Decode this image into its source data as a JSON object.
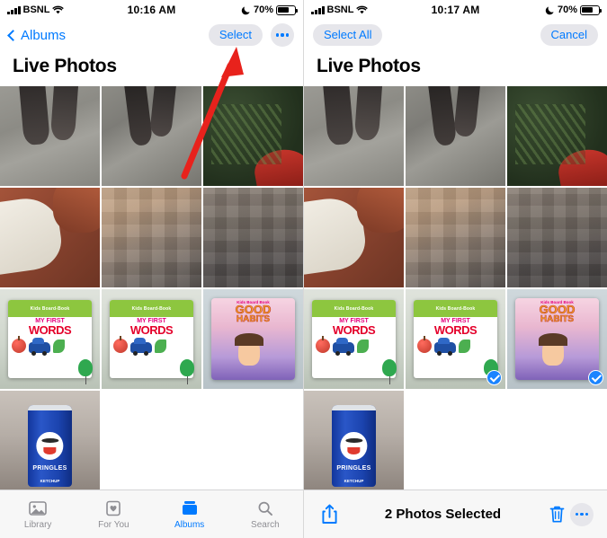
{
  "screens": [
    {
      "id": "before",
      "status_bar": {
        "carrier": "BSNL",
        "time": "10:16 AM",
        "battery_percent": "70%",
        "signal_icon": "cellular-bars-icon",
        "wifi_icon": "wifi-icon",
        "moon_icon": "do-not-disturb-moon-icon",
        "battery_icon": "battery-icon"
      },
      "nav": {
        "back_label": "Albums",
        "back_icon": "chevron-left-icon",
        "select_label": "Select",
        "more_icon": "ellipsis-circle-icon"
      },
      "title": "Live Photos",
      "photos": [
        {
          "name": "feet-on-pavement-1",
          "art": "feet",
          "selected": false
        },
        {
          "name": "feet-on-pavement-2",
          "art": "feet2",
          "selected": false
        },
        {
          "name": "foliage-with-red-object",
          "art": "foliage",
          "selected": false
        },
        {
          "name": "white-bowl-on-brown-surface",
          "art": "bowl",
          "selected": false
        },
        {
          "name": "blurred-photo-1",
          "art": "blurry",
          "selected": false
        },
        {
          "name": "blurred-photo-2",
          "art": "blurry2",
          "selected": false
        },
        {
          "name": "book-my-first-words-1",
          "art": "words",
          "selected": false
        },
        {
          "name": "book-my-first-words-2",
          "art": "words",
          "selected": false
        },
        {
          "name": "book-good-habits",
          "art": "habits",
          "selected": false
        },
        {
          "name": "pringles-ketchup-can",
          "art": "pringles",
          "selected": false
        },
        {
          "name": "empty-slot-1",
          "art": "empty",
          "selected": false
        },
        {
          "name": "empty-slot-2",
          "art": "empty",
          "selected": false
        }
      ],
      "tabbar": [
        {
          "label": "Library",
          "icon": "photos-library-icon",
          "active": false
        },
        {
          "label": "For You",
          "icon": "for-you-heart-icon",
          "active": false
        },
        {
          "label": "Albums",
          "icon": "albums-book-icon",
          "active": true
        },
        {
          "label": "Search",
          "icon": "search-magnifier-icon",
          "active": false
        }
      ],
      "annotation": {
        "type": "red-arrow",
        "points_to": "Select"
      }
    },
    {
      "id": "after",
      "status_bar": {
        "carrier": "BSNL",
        "time": "10:17 AM",
        "battery_percent": "70%",
        "signal_icon": "cellular-bars-icon",
        "wifi_icon": "wifi-icon",
        "moon_icon": "do-not-disturb-moon-icon",
        "battery_icon": "battery-icon"
      },
      "nav": {
        "select_all_label": "Select All",
        "cancel_label": "Cancel"
      },
      "title": "Live Photos",
      "photos": [
        {
          "name": "feet-on-pavement-1",
          "art": "feet",
          "selected": false
        },
        {
          "name": "feet-on-pavement-2",
          "art": "feet2",
          "selected": false
        },
        {
          "name": "foliage-with-red-object",
          "art": "foliage",
          "selected": false
        },
        {
          "name": "white-bowl-on-brown-surface",
          "art": "bowl",
          "selected": false
        },
        {
          "name": "blurred-photo-1",
          "art": "blurry",
          "selected": false
        },
        {
          "name": "blurred-photo-2",
          "art": "blurry2",
          "selected": false
        },
        {
          "name": "book-my-first-words-1",
          "art": "words",
          "selected": false
        },
        {
          "name": "book-my-first-words-2",
          "art": "words",
          "selected": true
        },
        {
          "name": "book-good-habits",
          "art": "habits",
          "selected": true
        },
        {
          "name": "pringles-ketchup-can",
          "art": "pringles",
          "selected": false
        },
        {
          "name": "empty-slot-1",
          "art": "empty",
          "selected": false
        },
        {
          "name": "empty-slot-2",
          "art": "empty",
          "selected": false
        }
      ],
      "selection_toolbar": {
        "share_icon": "share-upload-icon",
        "count_label": "2 Photos Selected",
        "delete_icon": "trash-icon",
        "more_icon": "ellipsis-circle-icon"
      }
    }
  ],
  "book_art": {
    "kids_line": "Kids Board-Book",
    "my_first": "MY FIRST",
    "words": "WORDS",
    "habits_kids": "Kids Board Book",
    "good": "GOOD",
    "habits": "HABITS"
  },
  "can_art": {
    "brand": "PRINGLES",
    "flavor": "KETCHUP"
  },
  "colors": {
    "accent_blue": "#007aff",
    "selection_blue": "#1b84ff",
    "pill_grey": "#e6e6eb",
    "inactive_grey": "#8e8e93",
    "annotation_red": "#e8221c"
  }
}
